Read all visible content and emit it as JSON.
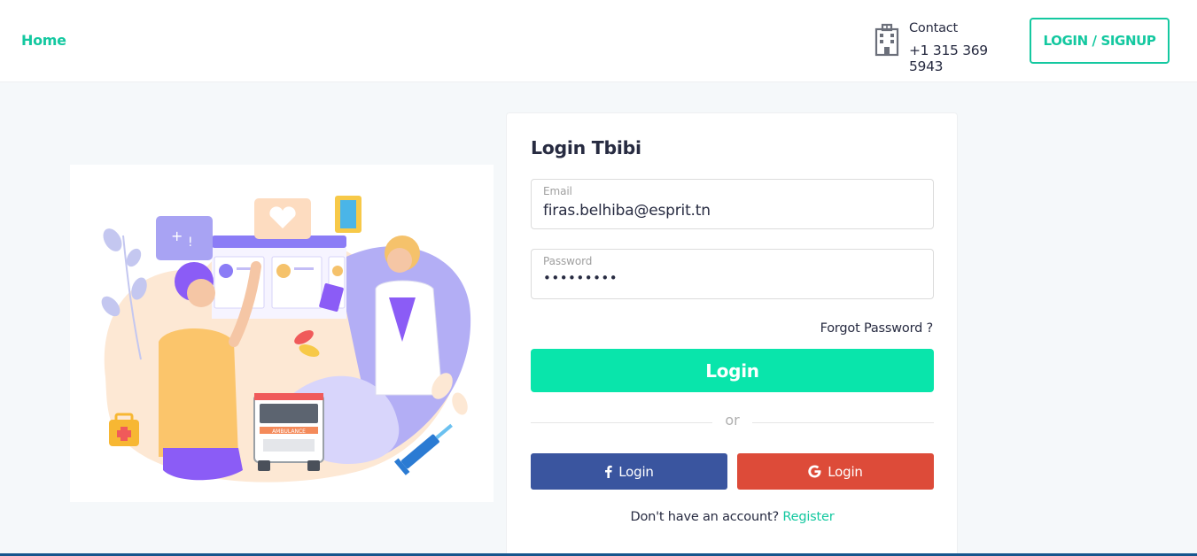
{
  "header": {
    "home_label": "Home",
    "contact_label": "Contact",
    "contact_phone": "+1 315 369 5943",
    "signup_label": "LOGIN / SIGNUP",
    "contact_icon": "building-icon"
  },
  "login": {
    "title": "Login Tbibi",
    "email_label": "Email",
    "email_value": "firas.belhiba@esprit.tn",
    "password_label": "Password",
    "password_value": "•••••••••",
    "forgot_label": "Forgot Password ?",
    "login_button": "Login",
    "or_label": "or",
    "facebook_label": "Login",
    "google_label": "Login",
    "no_account_text": "Don't have an account?",
    "register_label": "Register"
  },
  "illustration": {
    "ambulance_text": "AMBULANCE"
  },
  "colors": {
    "accent": "#09e5ab",
    "link": "#14c8a0",
    "facebook": "#3a559f",
    "google": "#dd4b39",
    "footer": "#15558d"
  }
}
